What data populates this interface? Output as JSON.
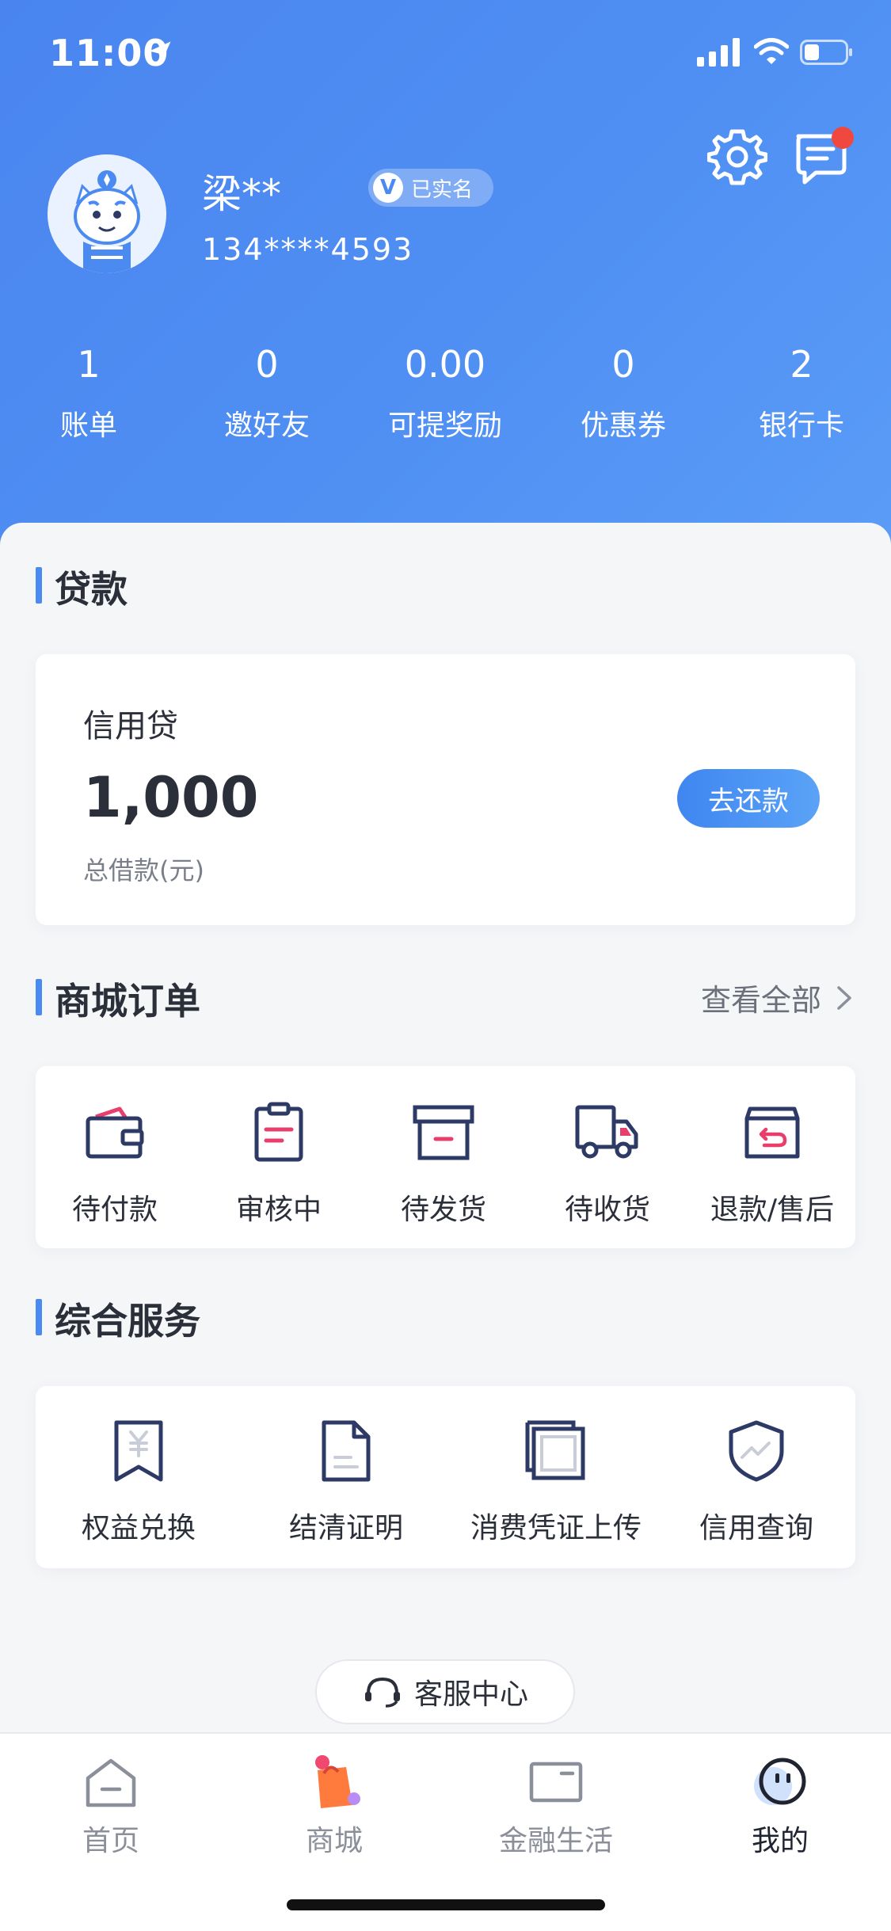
{
  "status_bar": {
    "time": "11:00"
  },
  "profile": {
    "name": "梁**",
    "verified_label": "已实名",
    "verified_icon_letter": "V",
    "phone": "134****4593"
  },
  "stats": [
    {
      "value": "1",
      "label": "账单"
    },
    {
      "value": "0",
      "label": "邀好友"
    },
    {
      "value": "0.00",
      "label": "可提奖励"
    },
    {
      "value": "0",
      "label": "优惠券"
    },
    {
      "value": "2",
      "label": "银行卡"
    }
  ],
  "loan": {
    "section_title": "贷款",
    "product_name": "信用贷",
    "amount": "1,000",
    "amount_label": "总借款(元)",
    "repay_button": "去还款"
  },
  "orders": {
    "section_title": "商城订单",
    "view_all": "查看全部",
    "items": [
      {
        "label": "待付款",
        "icon": "wallet-icon"
      },
      {
        "label": "审核中",
        "icon": "clipboard-icon"
      },
      {
        "label": "待发货",
        "icon": "box-icon"
      },
      {
        "label": "待收货",
        "icon": "truck-icon"
      },
      {
        "label": "退款/售后",
        "icon": "return-box-icon"
      }
    ]
  },
  "services": {
    "section_title": "综合服务",
    "items": [
      {
        "label": "权益兑换",
        "icon": "yuan-bookmark-icon"
      },
      {
        "label": "结清证明",
        "icon": "document-icon"
      },
      {
        "label": "消费凭证上传",
        "icon": "stacked-pages-icon"
      },
      {
        "label": "信用查询",
        "icon": "shield-chart-icon"
      }
    ]
  },
  "customer_service": {
    "label": "客服中心"
  },
  "tabbar": {
    "items": [
      {
        "label": "首页",
        "active": false
      },
      {
        "label": "商城",
        "active": false
      },
      {
        "label": "金融生活",
        "active": false
      },
      {
        "label": "我的",
        "active": true
      }
    ]
  },
  "colors": {
    "primary": "#4b8af0",
    "accent_red": "#f0483e",
    "icon_navy": "#2e3a66",
    "icon_pink": "#e83e6c"
  }
}
